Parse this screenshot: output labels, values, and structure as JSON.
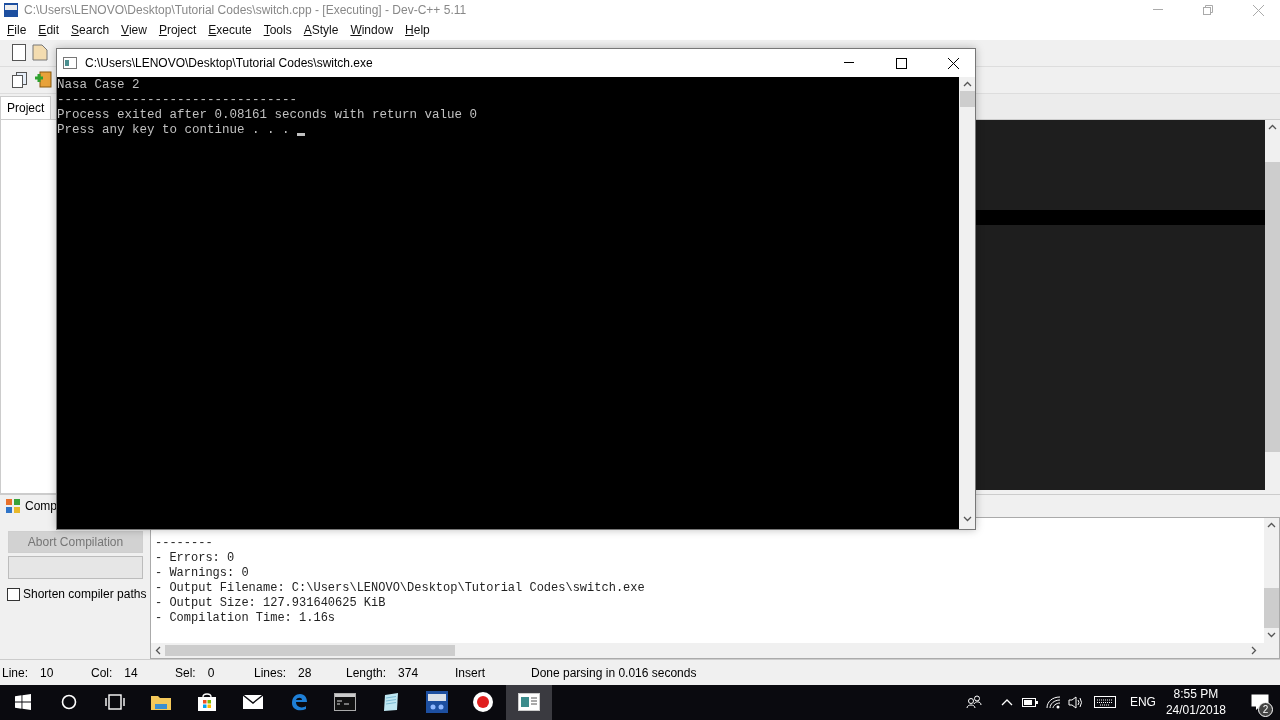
{
  "ide": {
    "title": "C:\\Users\\LENOVO\\Desktop\\Tutorial Codes\\switch.cpp - [Executing] - Dev-C++ 5.11",
    "menu": [
      "File",
      "Edit",
      "Search",
      "View",
      "Project",
      "Execute",
      "Tools",
      "AStyle",
      "Window",
      "Help"
    ],
    "left_tabs": [
      {
        "label": "Project",
        "selected": true
      }
    ]
  },
  "console": {
    "title": "C:\\Users\\LENOVO\\Desktop\\Tutorial Codes\\switch.exe",
    "lines": [
      "Nasa Case 2",
      "--------------------------------",
      "Process exited after 0.08161 seconds with return value 0",
      "Press any key to continue . . . "
    ]
  },
  "bottom_panel": {
    "tab": "Comp",
    "abort_button": {
      "label": "Abort Compilation",
      "disabled": true
    },
    "shorten_paths": {
      "label": "Shorten compiler paths",
      "checked": false
    },
    "output": [
      "--------",
      "- Errors: 0",
      "- Warnings: 0",
      "- Output Filename: C:\\Users\\LENOVO\\Desktop\\Tutorial Codes\\switch.exe",
      "- Output Size: 127.931640625 KiB",
      "- Compilation Time: 1.16s"
    ]
  },
  "status_bar": {
    "fields": [
      {
        "label": "Line:",
        "value": "10"
      },
      {
        "label": "Col:",
        "value": "14"
      },
      {
        "label": "Sel:",
        "value": "0"
      },
      {
        "label": "Lines:",
        "value": "28"
      },
      {
        "label": "Length:",
        "value": "374"
      }
    ],
    "mode": "Insert",
    "message": "Done parsing in 0.016 seconds"
  },
  "taskbar": {
    "apps": [
      {
        "kind": "start",
        "selected": false
      },
      {
        "kind": "search",
        "selected": false
      },
      {
        "kind": "taskview",
        "selected": false
      },
      {
        "kind": "explorer",
        "selected": false
      },
      {
        "kind": "store",
        "selected": false
      },
      {
        "kind": "mail",
        "selected": false
      },
      {
        "kind": "edge",
        "selected": false
      },
      {
        "kind": "console",
        "selected": false
      },
      {
        "kind": "notepad",
        "selected": false
      },
      {
        "kind": "devcpp",
        "selected": false
      },
      {
        "kind": "recorder",
        "selected": false
      },
      {
        "kind": "window",
        "selected": true
      }
    ],
    "tray": {
      "language": "ENG",
      "time": "8:55 PM",
      "date": "24/01/2018",
      "notifications": "2"
    }
  }
}
